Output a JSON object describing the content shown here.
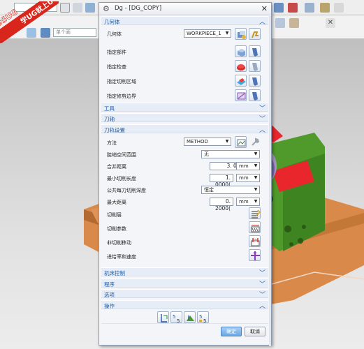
{
  "dialog": {
    "title": "Dg - [DG_COPY]",
    "close_glyph": "✕"
  },
  "watermark": {
    "text": "学UG就上UG网",
    "brand": "9SUG",
    "color": "#d9261c"
  },
  "background_toolbar": {
    "search_placeholder": "单个面"
  },
  "sections": {
    "geometry": {
      "title": "几何体",
      "geometry_label": "几何体",
      "geometry_value": "WORKPIECE_1",
      "specify_part": "指定部件",
      "specify_check": "指定检查",
      "specify_cut_area": "指定切削区域",
      "specify_trim": "指定修剪边界"
    },
    "tool": {
      "title": "工具"
    },
    "axis": {
      "title": "刀轴"
    },
    "path_settings": {
      "title": "刀轨设置",
      "method_label": "方法",
      "method_value": "METHOD",
      "slant_label": "陡峭空间范围",
      "slant_value": "无",
      "merge_label": "合并距离",
      "merge_value": "3. 0000(",
      "merge_unit": "mm",
      "min_cut_label": "最小切削长度",
      "min_cut_value": "1. 0000(",
      "min_cut_unit": "mm",
      "depth_label": "公共每刀切削深度",
      "depth_value": "恒定",
      "max_dist_label": "最大距离",
      "max_dist_value": "0. 2000(",
      "max_dist_unit": "mm",
      "cut_levels": "切削层",
      "cut_params": "切削参数",
      "non_cut_moves": "非切削移动",
      "feeds_speeds": "进给率和速度"
    },
    "machine": {
      "title": "机床控制"
    },
    "program": {
      "title": "程序"
    },
    "options": {
      "title": "选项"
    },
    "actions": {
      "title": "操作"
    }
  },
  "buttons": {
    "ok": "确定",
    "cancel": "取消"
  },
  "icons": [
    "gear-icon",
    "close-icon",
    "select-geometry-icon",
    "edit-icon",
    "part-icon",
    "check-icon",
    "cut-area-icon",
    "trim-boundary-icon",
    "chevron-up-icon",
    "chevron-down-icon",
    "method-icon",
    "cut-levels-icon",
    "cut-params-icon",
    "non-cut-moves-icon",
    "feeds-speeds-icon",
    "generate-icon",
    "replay-icon",
    "verify-icon",
    "list-icon"
  ],
  "colors": {
    "section_title": "#1c5aa6",
    "part_green": "#4f9a2b",
    "part_red": "#e8262b",
    "base_orange": "#d98a4a",
    "ok_button": "#6aa8e3"
  }
}
